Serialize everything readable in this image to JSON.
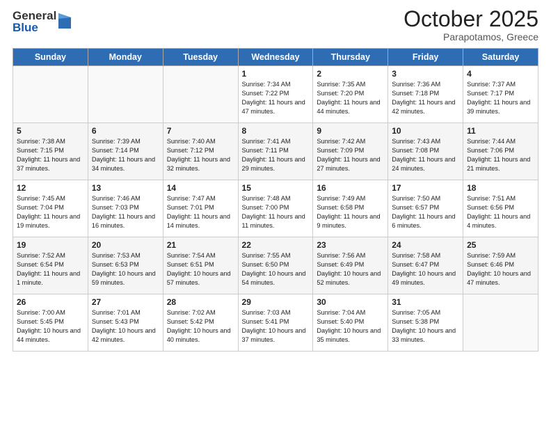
{
  "header": {
    "logo_general": "General",
    "logo_blue": "Blue",
    "month": "October 2025",
    "location": "Parapotamos, Greece"
  },
  "days_of_week": [
    "Sunday",
    "Monday",
    "Tuesday",
    "Wednesday",
    "Thursday",
    "Friday",
    "Saturday"
  ],
  "weeks": [
    [
      {
        "day": "",
        "info": ""
      },
      {
        "day": "",
        "info": ""
      },
      {
        "day": "",
        "info": ""
      },
      {
        "day": "1",
        "info": "Sunrise: 7:34 AM\nSunset: 7:22 PM\nDaylight: 11 hours\nand 47 minutes."
      },
      {
        "day": "2",
        "info": "Sunrise: 7:35 AM\nSunset: 7:20 PM\nDaylight: 11 hours\nand 44 minutes."
      },
      {
        "day": "3",
        "info": "Sunrise: 7:36 AM\nSunset: 7:18 PM\nDaylight: 11 hours\nand 42 minutes."
      },
      {
        "day": "4",
        "info": "Sunrise: 7:37 AM\nSunset: 7:17 PM\nDaylight: 11 hours\nand 39 minutes."
      }
    ],
    [
      {
        "day": "5",
        "info": "Sunrise: 7:38 AM\nSunset: 7:15 PM\nDaylight: 11 hours\nand 37 minutes."
      },
      {
        "day": "6",
        "info": "Sunrise: 7:39 AM\nSunset: 7:14 PM\nDaylight: 11 hours\nand 34 minutes."
      },
      {
        "day": "7",
        "info": "Sunrise: 7:40 AM\nSunset: 7:12 PM\nDaylight: 11 hours\nand 32 minutes."
      },
      {
        "day": "8",
        "info": "Sunrise: 7:41 AM\nSunset: 7:11 PM\nDaylight: 11 hours\nand 29 minutes."
      },
      {
        "day": "9",
        "info": "Sunrise: 7:42 AM\nSunset: 7:09 PM\nDaylight: 11 hours\nand 27 minutes."
      },
      {
        "day": "10",
        "info": "Sunrise: 7:43 AM\nSunset: 7:08 PM\nDaylight: 11 hours\nand 24 minutes."
      },
      {
        "day": "11",
        "info": "Sunrise: 7:44 AM\nSunset: 7:06 PM\nDaylight: 11 hours\nand 21 minutes."
      }
    ],
    [
      {
        "day": "12",
        "info": "Sunrise: 7:45 AM\nSunset: 7:04 PM\nDaylight: 11 hours\nand 19 minutes."
      },
      {
        "day": "13",
        "info": "Sunrise: 7:46 AM\nSunset: 7:03 PM\nDaylight: 11 hours\nand 16 minutes."
      },
      {
        "day": "14",
        "info": "Sunrise: 7:47 AM\nSunset: 7:01 PM\nDaylight: 11 hours\nand 14 minutes."
      },
      {
        "day": "15",
        "info": "Sunrise: 7:48 AM\nSunset: 7:00 PM\nDaylight: 11 hours\nand 11 minutes."
      },
      {
        "day": "16",
        "info": "Sunrise: 7:49 AM\nSunset: 6:58 PM\nDaylight: 11 hours\nand 9 minutes."
      },
      {
        "day": "17",
        "info": "Sunrise: 7:50 AM\nSunset: 6:57 PM\nDaylight: 11 hours\nand 6 minutes."
      },
      {
        "day": "18",
        "info": "Sunrise: 7:51 AM\nSunset: 6:56 PM\nDaylight: 11 hours\nand 4 minutes."
      }
    ],
    [
      {
        "day": "19",
        "info": "Sunrise: 7:52 AM\nSunset: 6:54 PM\nDaylight: 11 hours\nand 1 minute."
      },
      {
        "day": "20",
        "info": "Sunrise: 7:53 AM\nSunset: 6:53 PM\nDaylight: 10 hours\nand 59 minutes."
      },
      {
        "day": "21",
        "info": "Sunrise: 7:54 AM\nSunset: 6:51 PM\nDaylight: 10 hours\nand 57 minutes."
      },
      {
        "day": "22",
        "info": "Sunrise: 7:55 AM\nSunset: 6:50 PM\nDaylight: 10 hours\nand 54 minutes."
      },
      {
        "day": "23",
        "info": "Sunrise: 7:56 AM\nSunset: 6:49 PM\nDaylight: 10 hours\nand 52 minutes."
      },
      {
        "day": "24",
        "info": "Sunrise: 7:58 AM\nSunset: 6:47 PM\nDaylight: 10 hours\nand 49 minutes."
      },
      {
        "day": "25",
        "info": "Sunrise: 7:59 AM\nSunset: 6:46 PM\nDaylight: 10 hours\nand 47 minutes."
      }
    ],
    [
      {
        "day": "26",
        "info": "Sunrise: 7:00 AM\nSunset: 5:45 PM\nDaylight: 10 hours\nand 44 minutes."
      },
      {
        "day": "27",
        "info": "Sunrise: 7:01 AM\nSunset: 5:43 PM\nDaylight: 10 hours\nand 42 minutes."
      },
      {
        "day": "28",
        "info": "Sunrise: 7:02 AM\nSunset: 5:42 PM\nDaylight: 10 hours\nand 40 minutes."
      },
      {
        "day": "29",
        "info": "Sunrise: 7:03 AM\nSunset: 5:41 PM\nDaylight: 10 hours\nand 37 minutes."
      },
      {
        "day": "30",
        "info": "Sunrise: 7:04 AM\nSunset: 5:40 PM\nDaylight: 10 hours\nand 35 minutes."
      },
      {
        "day": "31",
        "info": "Sunrise: 7:05 AM\nSunset: 5:38 PM\nDaylight: 10 hours\nand 33 minutes."
      },
      {
        "day": "",
        "info": ""
      }
    ]
  ]
}
